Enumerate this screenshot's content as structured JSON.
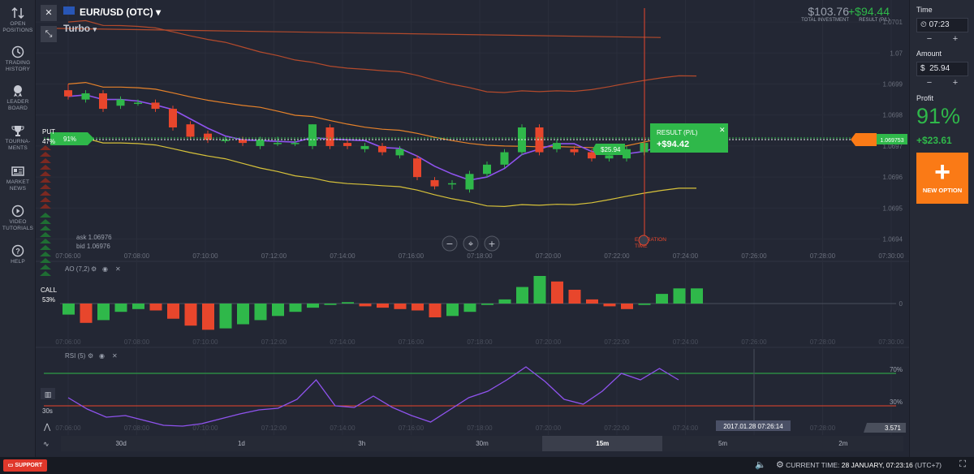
{
  "nav": [
    {
      "label1": "OPEN",
      "label2": "POSITIONS",
      "icon": "arrows-icon"
    },
    {
      "label1": "TRADING",
      "label2": "HISTORY",
      "icon": "clock-icon"
    },
    {
      "label1": "LEADER",
      "label2": "BOARD",
      "icon": "medal-icon"
    },
    {
      "label1": "TOURNA-",
      "label2": "MENTS",
      "icon": "trophy-icon"
    },
    {
      "label1": "MARKET",
      "label2": "NEWS",
      "icon": "news-icon"
    },
    {
      "label1": "VIDEO",
      "label2": "TUTORIALS",
      "icon": "play-icon"
    },
    {
      "label1": "HELP",
      "label2": "",
      "icon": "question-icon"
    }
  ],
  "header": {
    "asset": "EUR/USD (OTC)",
    "mode": "Turbo"
  },
  "account": {
    "investment": "$103.76",
    "investment_label": "TOTAL INVESTMENT",
    "result": "+$94.44",
    "result_label": "RESULT (P/L)"
  },
  "right": {
    "time_label": "Time",
    "time_value": "07:23",
    "amount_label": "Amount",
    "amount_value": "25.94",
    "currency": "$",
    "profit_label": "Profit",
    "profit_pct": "91%",
    "profit_value": "+$23.61",
    "new_option": "NEW OPTION",
    "minus": "−",
    "plus": "+"
  },
  "chart": {
    "put_label": "PUT",
    "put_pct": "47%",
    "call_label": "CALL",
    "call_pct": "53%",
    "payout_tag": "91%",
    "ask": "ask 1.06976",
    "bid": "bid 1.06976",
    "result_title": "RESULT (P/L)",
    "result_value": "+$94.42",
    "trade_tag": "$25.94",
    "current_price": "1.069753",
    "expiration_1": "EXPIRATION",
    "expiration_2": "TIME",
    "y_ticks": [
      "1.0701",
      "1.07",
      "1.0699",
      "1.0698",
      "1.0697",
      "1.0696",
      "1.0695",
      "1.0694"
    ],
    "x_ticks": [
      "07:06:00",
      "07:08:00",
      "07:10:00",
      "07:12:00",
      "07:14:00",
      "07:16:00",
      "07:18:00",
      "07:20:00",
      "07:22:00",
      "07:24:00",
      "07:26:00",
      "07:28:00",
      "07:30:00"
    ],
    "ao_label": "AO (7,2)",
    "ao_zero": "0",
    "rsi_label": "RSI (5)",
    "rsi_70": "70%",
    "rsi_30": "30%",
    "rsi_value": "3.571",
    "cursor_time": "2017.01.28 07:26:14",
    "interval_label": "30s",
    "colors": {
      "up": "#2fb84a",
      "down": "#e8462c",
      "rsi": "#8f53ee",
      "accent": "#fa7a16"
    }
  },
  "chart_data": {
    "type": "candlestick",
    "candles": [
      {
        "o": 1.06988,
        "c": 1.06986,
        "h": 1.0699,
        "l": 1.06985
      },
      {
        "o": 1.06985,
        "c": 1.06987,
        "h": 1.06988,
        "l": 1.06984
      },
      {
        "o": 1.06987,
        "c": 1.06982,
        "h": 1.06988,
        "l": 1.06981
      },
      {
        "o": 1.06983,
        "c": 1.06985,
        "h": 1.06986,
        "l": 1.06982
      },
      {
        "o": 1.06984,
        "c": 1.06984,
        "h": 1.06985,
        "l": 1.06983
      },
      {
        "o": 1.06984,
        "c": 1.06982,
        "h": 1.06985,
        "l": 1.06981
      },
      {
        "o": 1.06982,
        "c": 1.06976,
        "h": 1.06983,
        "l": 1.06975
      },
      {
        "o": 1.06977,
        "c": 1.06973,
        "h": 1.06978,
        "l": 1.06972
      },
      {
        "o": 1.06974,
        "c": 1.06972,
        "h": 1.06975,
        "l": 1.06971
      },
      {
        "o": 1.06972,
        "c": 1.06972,
        "h": 1.06973,
        "l": 1.06971
      },
      {
        "o": 1.06972,
        "c": 1.06971,
        "h": 1.06973,
        "l": 1.0697
      },
      {
        "o": 1.0697,
        "c": 1.06972,
        "h": 1.06973,
        "l": 1.06969
      },
      {
        "o": 1.06971,
        "c": 1.06971,
        "h": 1.06973,
        "l": 1.0697
      },
      {
        "o": 1.06971,
        "c": 1.06971,
        "h": 1.06972,
        "l": 1.0697
      },
      {
        "o": 1.0697,
        "c": 1.06977,
        "h": 1.06977,
        "l": 1.06969
      },
      {
        "o": 1.06976,
        "c": 1.0697,
        "h": 1.06977,
        "l": 1.06969
      },
      {
        "o": 1.06971,
        "c": 1.0697,
        "h": 1.06972,
        "l": 1.06969
      },
      {
        "o": 1.06969,
        "c": 1.0697,
        "h": 1.06971,
        "l": 1.06968
      },
      {
        "o": 1.0697,
        "c": 1.06968,
        "h": 1.06971,
        "l": 1.06967
      },
      {
        "o": 1.06967,
        "c": 1.06969,
        "h": 1.0697,
        "l": 1.06966
      },
      {
        "o": 1.06966,
        "c": 1.0696,
        "h": 1.06967,
        "l": 1.06959
      },
      {
        "o": 1.06959,
        "c": 1.06957,
        "h": 1.0696,
        "l": 1.06956
      },
      {
        "o": 1.06958,
        "c": 1.06958,
        "h": 1.06959,
        "l": 1.06956
      },
      {
        "o": 1.06956,
        "c": 1.06961,
        "h": 1.06962,
        "l": 1.06955
      },
      {
        "o": 1.06961,
        "c": 1.06964,
        "h": 1.06965,
        "l": 1.0696
      },
      {
        "o": 1.06964,
        "c": 1.06968,
        "h": 1.06969,
        "l": 1.06963
      },
      {
        "o": 1.06968,
        "c": 1.06976,
        "h": 1.06977,
        "l": 1.06967
      },
      {
        "o": 1.06976,
        "c": 1.06968,
        "h": 1.06977,
        "l": 1.06967
      },
      {
        "o": 1.06969,
        "c": 1.06971,
        "h": 1.06972,
        "l": 1.06968
      },
      {
        "o": 1.06969,
        "c": 1.06968,
        "h": 1.0697,
        "l": 1.06967
      },
      {
        "o": 1.06968,
        "c": 1.06966,
        "h": 1.06969,
        "l": 1.06965
      },
      {
        "o": 1.06966,
        "c": 1.06967,
        "h": 1.06968,
        "l": 1.06965
      },
      {
        "o": 1.06966,
        "c": 1.06969,
        "h": 1.0697,
        "l": 1.06965
      },
      {
        "o": 1.06968,
        "c": 1.06971,
        "h": 1.06972,
        "l": 1.06967
      },
      {
        "o": 1.06971,
        "c": 1.06973,
        "h": 1.06974,
        "l": 1.0697
      },
      {
        "o": 1.06973,
        "c": 1.06975,
        "h": 1.06976,
        "l": 1.06972
      },
      {
        "o": 1.06975,
        "c": 1.06976,
        "h": 1.06977,
        "l": 1.06974
      }
    ],
    "ao": [
      -8,
      -14,
      -12,
      -6,
      -4,
      -5,
      -11,
      -16,
      -19,
      -18,
      -15,
      -12,
      -9,
      -6,
      -3,
      -1,
      1,
      -2,
      -3,
      -4,
      -5,
      -10,
      -9,
      -6,
      -1,
      3,
      12,
      20,
      16,
      10,
      3,
      -2,
      -4,
      -1,
      7,
      11,
      11
    ],
    "rsi": [
      40,
      26,
      16,
      18,
      12,
      6,
      5,
      8,
      14,
      20,
      25,
      27,
      38,
      62,
      30,
      28,
      42,
      28,
      18,
      10,
      25,
      40,
      48,
      62,
      78,
      60,
      38,
      32,
      48,
      70,
      62,
      76,
      62
    ],
    "ylim": [
      1.06937,
      1.07015
    ],
    "rsi_ylim": [
      0,
      100
    ]
  },
  "timeframes": [
    "30d",
    "1d",
    "3h",
    "30m",
    "15m",
    "5m",
    "2m"
  ],
  "timeframe_active": "15m",
  "bottom": {
    "support": "SUPPORT",
    "clock_label": "CURRENT TIME:",
    "clock_value": "28 JANUARY, 07:23:16",
    "tz": "(UTC+7)"
  }
}
